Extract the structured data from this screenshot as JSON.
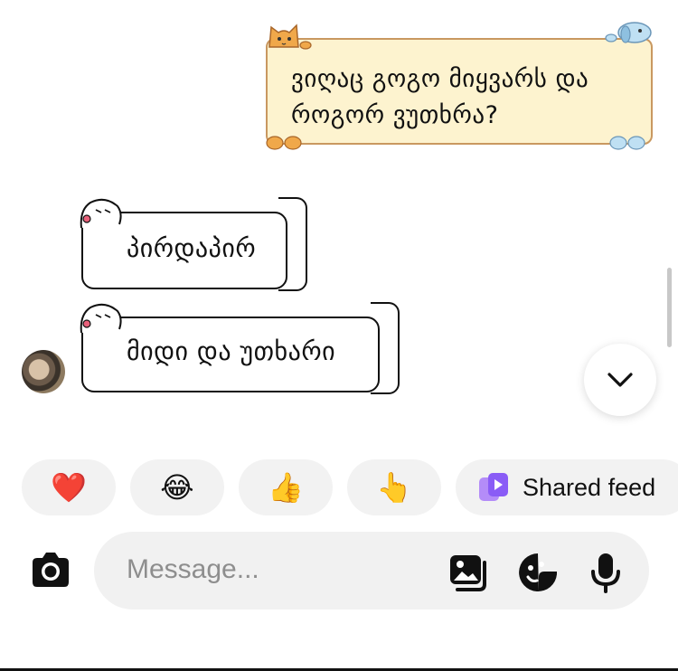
{
  "thread": {
    "sent_message": {
      "text_line1": "ვიღაც გოგო მიყვარს და",
      "text_line2": "როგორ ვუთხრა?",
      "theme": "cat",
      "bubble_color": "#fdf3cf"
    },
    "received_messages": [
      {
        "text": "პირდაპირ"
      },
      {
        "text": "მიდი და უთხარი"
      }
    ]
  },
  "quick_reactions": {
    "items": [
      {
        "emoji": "❤️",
        "name": "heart"
      },
      {
        "emoji": "😂",
        "name": "laughing"
      },
      {
        "emoji": "👍",
        "name": "thumbs-up"
      },
      {
        "emoji": "👆",
        "name": "point-up"
      }
    ],
    "shared_feed_label": "Shared feed",
    "accent": "#8a5cf6"
  },
  "composer": {
    "placeholder": "Message...",
    "icons": [
      "camera-icon",
      "gallery-icon",
      "sticker-icon",
      "mic-icon"
    ]
  }
}
